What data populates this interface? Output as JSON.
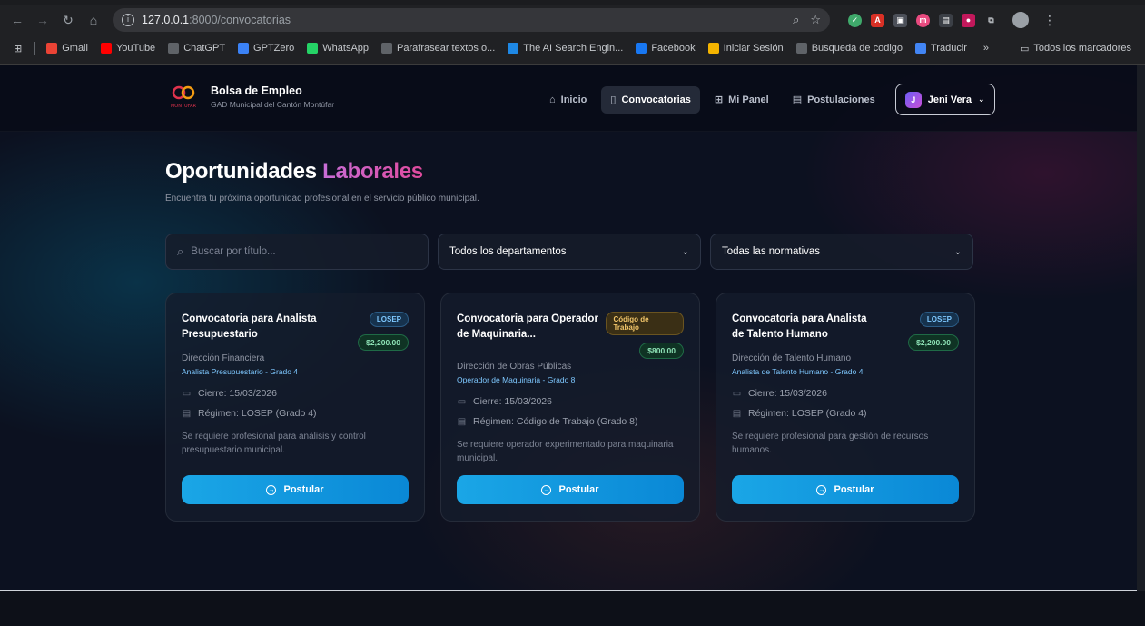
{
  "browser": {
    "url_host": "127.0.0.1",
    "url_path": ":8000/convocatorias",
    "bookmarks": [
      {
        "label": "Gmail",
        "icon": "gmail-icon",
        "color": "#ea4335"
      },
      {
        "label": "YouTube",
        "icon": "youtube-icon",
        "color": "#ff0000"
      },
      {
        "label": "ChatGPT",
        "icon": "chatgpt-icon",
        "color": "#5f6368"
      },
      {
        "label": "GPTZero",
        "icon": "gptzero-icon",
        "color": "#3b82f6"
      },
      {
        "label": "WhatsApp",
        "icon": "whatsapp-icon",
        "color": "#25d366"
      },
      {
        "label": "Parafrasear textos o...",
        "icon": "paraphrase-icon",
        "color": "#5f6368"
      },
      {
        "label": "The AI Search Engin...",
        "icon": "ai-search-icon",
        "color": "#1e88e5"
      },
      {
        "label": "Facebook",
        "icon": "facebook-icon",
        "color": "#1877f2"
      },
      {
        "label": "Iniciar Sesión",
        "icon": "login-icon",
        "color": "#f4b400"
      },
      {
        "label": "Busqueda de codigo",
        "icon": "code-search-icon",
        "color": "#5f6368"
      },
      {
        "label": "Traducir",
        "icon": "translate-icon",
        "color": "#4285f4"
      }
    ],
    "overflow_label": "»",
    "all_bookmarks_label": "Todos los marcadores"
  },
  "nav": {
    "brand_title": "Bolsa de Empleo",
    "brand_subtitle": "GAD Municipal del Cantón Montúfar",
    "logo_text": "MONTUFAR",
    "links": [
      {
        "label": "Inicio",
        "icon": "home-icon",
        "active": false
      },
      {
        "label": "Convocatorias",
        "icon": "clipboard-icon",
        "active": true
      },
      {
        "label": "Mi Panel",
        "icon": "grid-icon",
        "active": false
      },
      {
        "label": "Postulaciones",
        "icon": "document-icon",
        "active": false
      }
    ],
    "user_initial": "J",
    "user_name": "Jeni Vera"
  },
  "hero": {
    "title_main": "Oportunidades",
    "title_accent": "Laborales",
    "subtitle": "Encuentra tu próxima oportunidad profesional en el servicio público municipal."
  },
  "filters": {
    "search_placeholder": "Buscar por título...",
    "department_selected": "Todos los departamentos",
    "regime_selected": "Todas las normativas"
  },
  "cards": [
    {
      "title": "Convocatoria para Analista Presupuestario",
      "badge": "LOSEP",
      "badge_type": "losep",
      "salary": "$2,200.00",
      "department": "Dirección Financiera",
      "position": "Analista Presupuestario - Grado 4",
      "closing": "Cierre: 15/03/2026",
      "regime": "Régimen: LOSEP (Grado 4)",
      "description": "Se requiere profesional para análisis y control presupuestario municipal.",
      "apply_label": "Postular"
    },
    {
      "title": "Convocatoria para Operador de Maquinaria...",
      "badge": "Código de Trabajo",
      "badge_type": "codigo",
      "salary": "$800.00",
      "department": "Dirección de Obras Públicas",
      "position": "Operador de Maquinaria - Grado 8",
      "closing": "Cierre: 15/03/2026",
      "regime": "Régimen: Código de Trabajo (Grado 8)",
      "description": "Se requiere operador experimentado para maquinaria municipal.",
      "apply_label": "Postular"
    },
    {
      "title": "Convocatoria para Analista de Talento Humano",
      "badge": "LOSEP",
      "badge_type": "losep",
      "salary": "$2,200.00",
      "department": "Dirección de Talento Humano",
      "position": "Analista de Talento Humano - Grado 4",
      "closing": "Cierre: 15/03/2026",
      "regime": "Régimen: LOSEP (Grado 4)",
      "description": "Se requiere profesional para gestión de recursos humanos.",
      "apply_label": "Postular"
    }
  ]
}
